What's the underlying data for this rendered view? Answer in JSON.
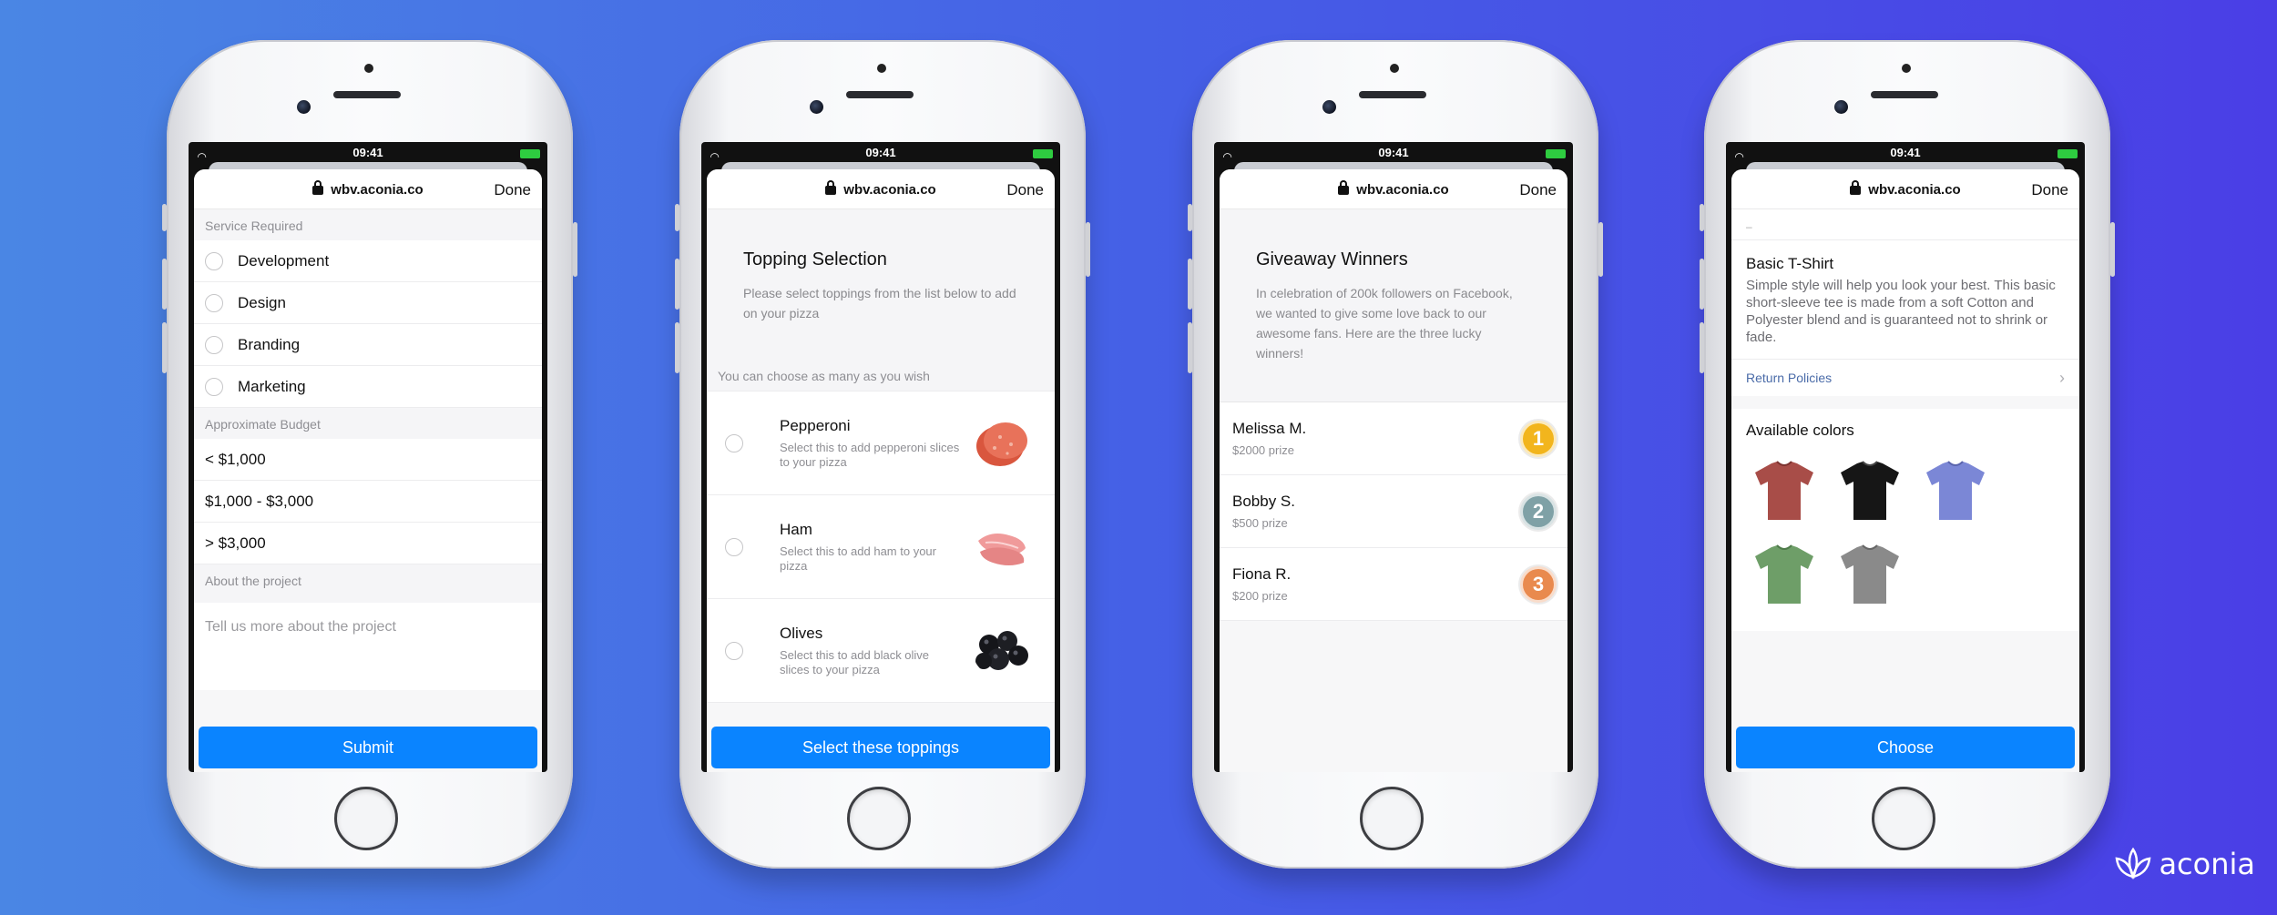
{
  "status_time": "09:41",
  "url": "wbv.aconia.co",
  "done_label": "Done",
  "phone1": {
    "service_label": "Service Required",
    "services": [
      "Development",
      "Design",
      "Branding",
      "Marketing"
    ],
    "budget_label": "Approximate Budget",
    "budgets": [
      "< $1,000",
      "$1,000 - $3,000",
      "> $3,000"
    ],
    "about_label": "About the project",
    "about_placeholder": "Tell us more about the project",
    "submit_label": "Submit"
  },
  "phone2": {
    "title": "Topping Selection",
    "subtitle": "Please select toppings from the list below to add on your pizza",
    "hint": "You can choose as many as you wish",
    "toppings": [
      {
        "name": "Pepperoni",
        "desc": "Select this to add pepperoni slices to your pizza"
      },
      {
        "name": "Ham",
        "desc": "Select this to add ham to your pizza"
      },
      {
        "name": "Olives",
        "desc": "Select this to add black olive slices to your pizza"
      }
    ],
    "submit_label": "Select these toppings"
  },
  "phone3": {
    "title": "Giveaway Winners",
    "subtitle": "In celebration of 200k followers on Facebook, we wanted to give some love back to our awesome fans. Here are the three lucky winners!",
    "winners": [
      {
        "name": "Melissa M.",
        "prize": "$2000 prize",
        "rank": "1",
        "color": "#f2b51d"
      },
      {
        "name": "Bobby S.",
        "prize": "$500 prize",
        "rank": "2",
        "color": "#7fa1a6"
      },
      {
        "name": "Fiona R.",
        "prize": "$200 prize",
        "rank": "3",
        "color": "#e98a4e"
      }
    ]
  },
  "phone4": {
    "dash": "–",
    "product_title": "Basic T-Shirt",
    "product_desc": "Simple style will help you look your best. This basic short-sleeve tee is made from a soft Cotton and Polyester blend and is guaranteed not to shrink or fade.",
    "return_link": "Return Policies",
    "colors_label": "Available colors",
    "colors": [
      "#a84d48",
      "#161616",
      "#7b87d6",
      "#6e9e68",
      "#8a8a8a"
    ],
    "submit_label": "Choose"
  },
  "logo_text": "aconia",
  "accent": "#0a84ff"
}
